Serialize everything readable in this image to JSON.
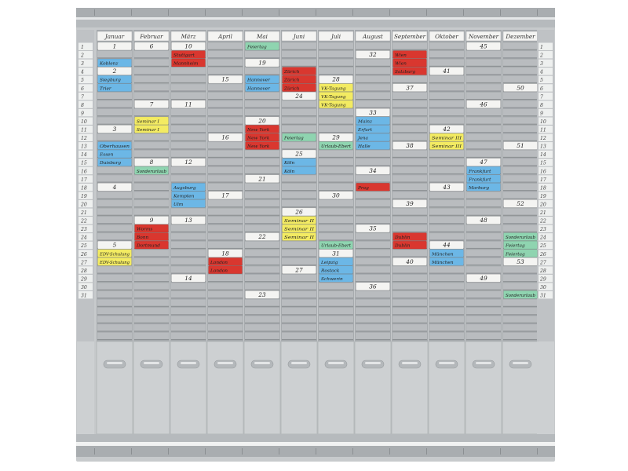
{
  "months": [
    "Januar",
    "Februar",
    "März",
    "April",
    "Mai",
    "Juni",
    "Juli",
    "August",
    "September",
    "Oktober",
    "November",
    "Dezember"
  ],
  "row_numbers": [
    "1",
    "2",
    "3",
    "4",
    "5",
    "6",
    "7",
    "8",
    "9",
    "10",
    "11",
    "12",
    "13",
    "14",
    "15",
    "16",
    "17",
    "18",
    "19",
    "20",
    "21",
    "22",
    "23",
    "24",
    "25",
    "26",
    "27",
    "28",
    "29",
    "30",
    "31"
  ],
  "colors": {
    "frame": "#c7cacc",
    "rail": "#a9adb0",
    "slot": "#b9bcbf",
    "slot_line": "#8e9295",
    "white": "#f4f4f2",
    "red": "#d9372f",
    "blue": "#6cb7e6",
    "yellow": "#f3eb62",
    "green": "#8fd4b0"
  },
  "cards": [
    {
      "month": 0,
      "row": 0,
      "color": "white",
      "text": "1"
    },
    {
      "month": 0,
      "row": 2,
      "color": "blue",
      "text": "Koblenz"
    },
    {
      "month": 0,
      "row": 3,
      "color": "white",
      "text": "2"
    },
    {
      "month": 0,
      "row": 4,
      "color": "blue",
      "text": "Siegburg"
    },
    {
      "month": 0,
      "row": 5,
      "color": "blue",
      "text": "Trier"
    },
    {
      "month": 0,
      "row": 10,
      "color": "white",
      "text": "3"
    },
    {
      "month": 0,
      "row": 12,
      "color": "blue",
      "text": "Oberhausen"
    },
    {
      "month": 0,
      "row": 13,
      "color": "blue",
      "text": "Essen"
    },
    {
      "month": 0,
      "row": 14,
      "color": "blue",
      "text": "Duisburg"
    },
    {
      "month": 0,
      "row": 17,
      "color": "white",
      "text": "4"
    },
    {
      "month": 0,
      "row": 24,
      "color": "white",
      "text": "5"
    },
    {
      "month": 0,
      "row": 25,
      "color": "yellow",
      "text": "EDV-Schulung"
    },
    {
      "month": 0,
      "row": 26,
      "color": "yellow",
      "text": "EDV-Schulung"
    },
    {
      "month": 1,
      "row": 0,
      "color": "white",
      "text": "6"
    },
    {
      "month": 1,
      "row": 7,
      "color": "white",
      "text": "7"
    },
    {
      "month": 1,
      "row": 9,
      "color": "yellow",
      "text": "Seminar I"
    },
    {
      "month": 1,
      "row": 10,
      "color": "yellow",
      "text": "Seminar I"
    },
    {
      "month": 1,
      "row": 14,
      "color": "white",
      "text": "8"
    },
    {
      "month": 1,
      "row": 15,
      "color": "green",
      "text": "Sonderurlaub"
    },
    {
      "month": 1,
      "row": 21,
      "color": "white",
      "text": "9"
    },
    {
      "month": 1,
      "row": 22,
      "color": "red",
      "text": "Worms"
    },
    {
      "month": 1,
      "row": 23,
      "color": "red",
      "text": "Bonn"
    },
    {
      "month": 1,
      "row": 24,
      "color": "red",
      "text": "Dortmund"
    },
    {
      "month": 2,
      "row": 0,
      "color": "white",
      "text": "10"
    },
    {
      "month": 2,
      "row": 1,
      "color": "red",
      "text": "Stuttgart"
    },
    {
      "month": 2,
      "row": 2,
      "color": "red",
      "text": "Mannheim"
    },
    {
      "month": 2,
      "row": 7,
      "color": "white",
      "text": "11"
    },
    {
      "month": 2,
      "row": 14,
      "color": "white",
      "text": "12"
    },
    {
      "month": 2,
      "row": 17,
      "color": "blue",
      "text": "Augsburg"
    },
    {
      "month": 2,
      "row": 18,
      "color": "blue",
      "text": "Kempten"
    },
    {
      "month": 2,
      "row": 19,
      "color": "blue",
      "text": "Ulm"
    },
    {
      "month": 2,
      "row": 21,
      "color": "white",
      "text": "13"
    },
    {
      "month": 2,
      "row": 28,
      "color": "white",
      "text": "14"
    },
    {
      "month": 3,
      "row": 4,
      "color": "white",
      "text": "15"
    },
    {
      "month": 3,
      "row": 11,
      "color": "white",
      "text": "16"
    },
    {
      "month": 3,
      "row": 18,
      "color": "white",
      "text": "17"
    },
    {
      "month": 3,
      "row": 25,
      "color": "white",
      "text": "18"
    },
    {
      "month": 3,
      "row": 26,
      "color": "red",
      "text": "London"
    },
    {
      "month": 3,
      "row": 27,
      "color": "red",
      "text": "London"
    },
    {
      "month": 4,
      "row": 0,
      "color": "green",
      "text": "Feiertag"
    },
    {
      "month": 4,
      "row": 2,
      "color": "white",
      "text": "19"
    },
    {
      "month": 4,
      "row": 4,
      "color": "blue",
      "text": "Hannover"
    },
    {
      "month": 4,
      "row": 5,
      "color": "blue",
      "text": "Hannover"
    },
    {
      "month": 4,
      "row": 9,
      "color": "white",
      "text": "20"
    },
    {
      "month": 4,
      "row": 10,
      "color": "red",
      "text": "New York"
    },
    {
      "month": 4,
      "row": 11,
      "color": "red",
      "text": "New York"
    },
    {
      "month": 4,
      "row": 12,
      "color": "red",
      "text": "New York"
    },
    {
      "month": 4,
      "row": 16,
      "color": "white",
      "text": "21"
    },
    {
      "month": 4,
      "row": 23,
      "color": "white",
      "text": "22"
    },
    {
      "month": 4,
      "row": 30,
      "color": "white",
      "text": "23"
    },
    {
      "month": 5,
      "row": 3,
      "color": "red",
      "text": "Zürich"
    },
    {
      "month": 5,
      "row": 4,
      "color": "red",
      "text": "Zürich"
    },
    {
      "month": 5,
      "row": 5,
      "color": "red",
      "text": "Zürich"
    },
    {
      "month": 5,
      "row": 6,
      "color": "white",
      "text": "24"
    },
    {
      "month": 5,
      "row": 11,
      "color": "green",
      "text": "Feiertag"
    },
    {
      "month": 5,
      "row": 13,
      "color": "white",
      "text": "25"
    },
    {
      "month": 5,
      "row": 14,
      "color": "blue",
      "text": "Köln"
    },
    {
      "month": 5,
      "row": 15,
      "color": "blue",
      "text": "Köln"
    },
    {
      "month": 5,
      "row": 20,
      "color": "white",
      "text": "26"
    },
    {
      "month": 5,
      "row": 21,
      "color": "yellow",
      "text": "Seminar II"
    },
    {
      "month": 5,
      "row": 22,
      "color": "yellow",
      "text": "Seminar II"
    },
    {
      "month": 5,
      "row": 23,
      "color": "yellow",
      "text": "Seminar II"
    },
    {
      "month": 5,
      "row": 27,
      "color": "white",
      "text": "27"
    },
    {
      "month": 6,
      "row": 4,
      "color": "white",
      "text": "28"
    },
    {
      "month": 6,
      "row": 5,
      "color": "yellow",
      "text": "VK-Tagung"
    },
    {
      "month": 6,
      "row": 6,
      "color": "yellow",
      "text": "VK-Tagung"
    },
    {
      "month": 6,
      "row": 7,
      "color": "yellow",
      "text": "VK-Tagung"
    },
    {
      "month": 6,
      "row": 11,
      "color": "white",
      "text": "29"
    },
    {
      "month": 6,
      "row": 12,
      "color": "green",
      "text": "Urlaub-Ebert"
    },
    {
      "month": 6,
      "row": 18,
      "color": "white",
      "text": "30"
    },
    {
      "month": 6,
      "row": 24,
      "color": "green",
      "text": "Urlaub-Ebert"
    },
    {
      "month": 6,
      "row": 25,
      "color": "white",
      "text": "31"
    },
    {
      "month": 6,
      "row": 26,
      "color": "blue",
      "text": "Leipzig"
    },
    {
      "month": 6,
      "row": 27,
      "color": "blue",
      "text": "Rostock"
    },
    {
      "month": 6,
      "row": 28,
      "color": "blue",
      "text": "Schwerin"
    },
    {
      "month": 7,
      "row": 1,
      "color": "white",
      "text": "32"
    },
    {
      "month": 7,
      "row": 8,
      "color": "white",
      "text": "33"
    },
    {
      "month": 7,
      "row": 9,
      "color": "blue",
      "text": "Mainz"
    },
    {
      "month": 7,
      "row": 10,
      "color": "blue",
      "text": "Erfurt"
    },
    {
      "month": 7,
      "row": 11,
      "color": "blue",
      "text": "Jena"
    },
    {
      "month": 7,
      "row": 12,
      "color": "blue",
      "text": "Halle"
    },
    {
      "month": 7,
      "row": 15,
      "color": "white",
      "text": "34"
    },
    {
      "month": 7,
      "row": 17,
      "color": "red",
      "text": "Prag"
    },
    {
      "month": 7,
      "row": 22,
      "color": "white",
      "text": "35"
    },
    {
      "month": 7,
      "row": 29,
      "color": "white",
      "text": "36"
    },
    {
      "month": 8,
      "row": 1,
      "color": "red",
      "text": "Wien"
    },
    {
      "month": 8,
      "row": 2,
      "color": "red",
      "text": "Wien"
    },
    {
      "month": 8,
      "row": 3,
      "color": "red",
      "text": "Salzburg"
    },
    {
      "month": 8,
      "row": 5,
      "color": "white",
      "text": "37"
    },
    {
      "month": 8,
      "row": 12,
      "color": "white",
      "text": "38"
    },
    {
      "month": 8,
      "row": 19,
      "color": "white",
      "text": "39"
    },
    {
      "month": 8,
      "row": 23,
      "color": "red",
      "text": "Dublin"
    },
    {
      "month": 8,
      "row": 24,
      "color": "red",
      "text": "Dublin"
    },
    {
      "month": 8,
      "row": 26,
      "color": "white",
      "text": "40"
    },
    {
      "month": 9,
      "row": 3,
      "color": "white",
      "text": "41"
    },
    {
      "month": 9,
      "row": 10,
      "color": "white",
      "text": "42"
    },
    {
      "month": 9,
      "row": 11,
      "color": "yellow",
      "text": "Seminar III"
    },
    {
      "month": 9,
      "row": 12,
      "color": "yellow",
      "text": "Seminar III"
    },
    {
      "month": 9,
      "row": 17,
      "color": "white",
      "text": "43"
    },
    {
      "month": 9,
      "row": 24,
      "color": "white",
      "text": "44"
    },
    {
      "month": 9,
      "row": 25,
      "color": "blue",
      "text": "München"
    },
    {
      "month": 9,
      "row": 26,
      "color": "blue",
      "text": "München"
    },
    {
      "month": 10,
      "row": 0,
      "color": "white",
      "text": "45"
    },
    {
      "month": 10,
      "row": 7,
      "color": "white",
      "text": "46"
    },
    {
      "month": 10,
      "row": 14,
      "color": "white",
      "text": "47"
    },
    {
      "month": 10,
      "row": 15,
      "color": "blue",
      "text": "Frankfurt"
    },
    {
      "month": 10,
      "row": 16,
      "color": "blue",
      "text": "Frankfurt"
    },
    {
      "month": 10,
      "row": 17,
      "color": "blue",
      "text": "Marburg"
    },
    {
      "month": 10,
      "row": 21,
      "color": "white",
      "text": "48"
    },
    {
      "month": 10,
      "row": 28,
      "color": "white",
      "text": "49"
    },
    {
      "month": 11,
      "row": 5,
      "color": "white",
      "text": "50"
    },
    {
      "month": 11,
      "row": 12,
      "color": "white",
      "text": "51"
    },
    {
      "month": 11,
      "row": 19,
      "color": "white",
      "text": "52"
    },
    {
      "month": 11,
      "row": 23,
      "color": "green",
      "text": "Sonderurlaub"
    },
    {
      "month": 11,
      "row": 24,
      "color": "green",
      "text": "Feiertag"
    },
    {
      "month": 11,
      "row": 25,
      "color": "green",
      "text": "Feiertag"
    },
    {
      "month": 11,
      "row": 26,
      "color": "white",
      "text": "53"
    },
    {
      "month": 11,
      "row": 30,
      "color": "green",
      "text": "Sonderurlaub"
    }
  ]
}
